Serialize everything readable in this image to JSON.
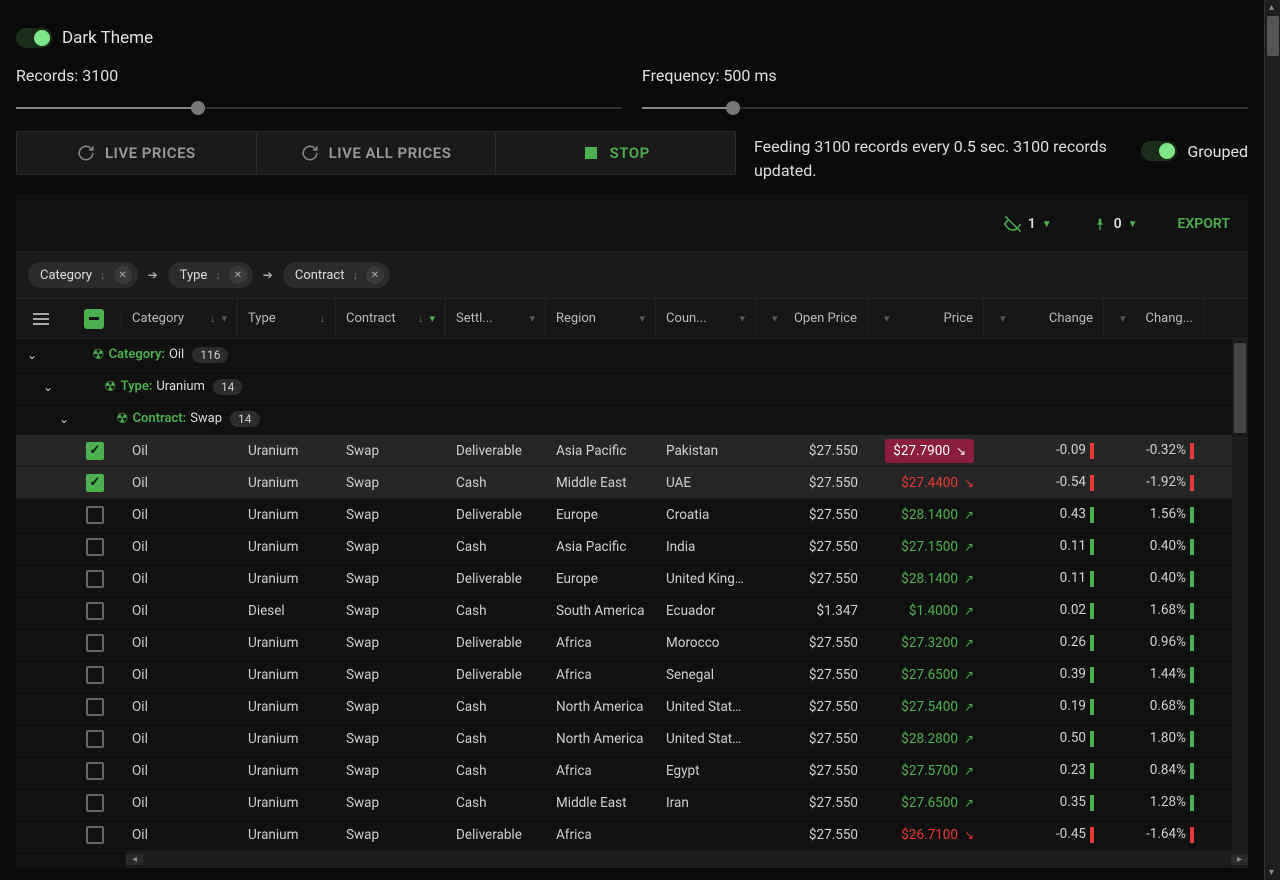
{
  "theme": {
    "label": "Dark Theme",
    "on": true
  },
  "records_slider": {
    "label": "Records: 3100",
    "percent": 30
  },
  "frequency_slider": {
    "label": "Frequency: 500 ms",
    "percent": 15
  },
  "buttons": {
    "live_prices": "LIVE PRICES",
    "live_all_prices": "LIVE ALL PRICES",
    "stop": "STOP"
  },
  "status": "Feeding 3100 records every 0.5 sec. 3100 records updated.",
  "grouped": {
    "label": "Grouped",
    "on": true
  },
  "actions": {
    "hidden_count": "1",
    "pinned_count": "0",
    "export": "EXPORT"
  },
  "groupby": [
    {
      "label": "Category"
    },
    {
      "label": "Type"
    },
    {
      "label": "Contract"
    }
  ],
  "columns": {
    "category": "Category",
    "type": "Type",
    "contract": "Contract",
    "settlement": "Settl...",
    "region": "Region",
    "country": "Coun...",
    "open_price": "Open Price",
    "price": "Price",
    "change": "Change",
    "change_pct": "Chang..."
  },
  "groups": {
    "g1": {
      "label": "Category:",
      "value": "Oil",
      "count": "116"
    },
    "g2": {
      "label": "Type:",
      "value": "Uranium",
      "count": "14"
    },
    "g3": {
      "label": "Contract:",
      "value": "Swap",
      "count": "14"
    }
  },
  "rows": [
    {
      "selected": true,
      "category": "Oil",
      "type": "Uranium",
      "contract": "Swap",
      "settlement": "Deliverable",
      "region": "Asia Pacific",
      "country": "Pakistan",
      "open_price": "$27.550",
      "price": "$27.7900",
      "dir": "down",
      "badge": true,
      "change": "-0.09",
      "chbar": "down",
      "change_pct": "-0.32%",
      "pctbar": "down"
    },
    {
      "selected": true,
      "category": "Oil",
      "type": "Uranium",
      "contract": "Swap",
      "settlement": "Cash",
      "region": "Middle East",
      "country": "UAE",
      "open_price": "$27.550",
      "price": "$27.4400",
      "dir": "down",
      "badge": false,
      "change": "-0.54",
      "chbar": "down",
      "change_pct": "-1.92%",
      "pctbar": "down"
    },
    {
      "selected": false,
      "category": "Oil",
      "type": "Uranium",
      "contract": "Swap",
      "settlement": "Deliverable",
      "region": "Europe",
      "country": "Croatia",
      "open_price": "$27.550",
      "price": "$28.1400",
      "dir": "up",
      "badge": false,
      "change": "0.43",
      "chbar": "up",
      "change_pct": "1.56%",
      "pctbar": "up"
    },
    {
      "selected": false,
      "category": "Oil",
      "type": "Uranium",
      "contract": "Swap",
      "settlement": "Cash",
      "region": "Asia Pacific",
      "country": "India",
      "open_price": "$27.550",
      "price": "$27.1500",
      "dir": "up",
      "badge": false,
      "change": "0.11",
      "chbar": "up",
      "change_pct": "0.40%",
      "pctbar": "up"
    },
    {
      "selected": false,
      "category": "Oil",
      "type": "Uranium",
      "contract": "Swap",
      "settlement": "Deliverable",
      "region": "Europe",
      "country": "United King…",
      "open_price": "$27.550",
      "price": "$28.1400",
      "dir": "up",
      "badge": false,
      "change": "0.11",
      "chbar": "up",
      "change_pct": "0.40%",
      "pctbar": "up"
    },
    {
      "selected": false,
      "category": "Oil",
      "type": "Diesel",
      "contract": "Swap",
      "settlement": "Cash",
      "region": "South America",
      "country": "Ecuador",
      "open_price": "$1.347",
      "price": "$1.4000",
      "dir": "up",
      "badge": false,
      "change": "0.02",
      "chbar": "up",
      "change_pct": "1.68%",
      "pctbar": "up"
    },
    {
      "selected": false,
      "category": "Oil",
      "type": "Uranium",
      "contract": "Swap",
      "settlement": "Deliverable",
      "region": "Africa",
      "country": "Morocco",
      "open_price": "$27.550",
      "price": "$27.3200",
      "dir": "up",
      "badge": false,
      "change": "0.26",
      "chbar": "up",
      "change_pct": "0.96%",
      "pctbar": "up"
    },
    {
      "selected": false,
      "category": "Oil",
      "type": "Uranium",
      "contract": "Swap",
      "settlement": "Deliverable",
      "region": "Africa",
      "country": "Senegal",
      "open_price": "$27.550",
      "price": "$27.6500",
      "dir": "up",
      "badge": false,
      "change": "0.39",
      "chbar": "up",
      "change_pct": "1.44%",
      "pctbar": "up"
    },
    {
      "selected": false,
      "category": "Oil",
      "type": "Uranium",
      "contract": "Swap",
      "settlement": "Cash",
      "region": "North America",
      "country": "United States",
      "open_price": "$27.550",
      "price": "$27.5400",
      "dir": "up",
      "badge": false,
      "change": "0.19",
      "chbar": "up",
      "change_pct": "0.68%",
      "pctbar": "up"
    },
    {
      "selected": false,
      "category": "Oil",
      "type": "Uranium",
      "contract": "Swap",
      "settlement": "Cash",
      "region": "North America",
      "country": "United States",
      "open_price": "$27.550",
      "price": "$28.2800",
      "dir": "up",
      "badge": false,
      "change": "0.50",
      "chbar": "up",
      "change_pct": "1.80%",
      "pctbar": "up"
    },
    {
      "selected": false,
      "category": "Oil",
      "type": "Uranium",
      "contract": "Swap",
      "settlement": "Cash",
      "region": "Africa",
      "country": "Egypt",
      "open_price": "$27.550",
      "price": "$27.5700",
      "dir": "up",
      "badge": false,
      "change": "0.23",
      "chbar": "up",
      "change_pct": "0.84%",
      "pctbar": "up"
    },
    {
      "selected": false,
      "category": "Oil",
      "type": "Uranium",
      "contract": "Swap",
      "settlement": "Cash",
      "region": "Middle East",
      "country": "Iran",
      "open_price": "$27.550",
      "price": "$27.6500",
      "dir": "up",
      "badge": false,
      "change": "0.35",
      "chbar": "up",
      "change_pct": "1.28%",
      "pctbar": "up"
    },
    {
      "selected": false,
      "category": "Oil",
      "type": "Uranium",
      "contract": "Swap",
      "settlement": "Deliverable",
      "region": "Africa",
      "country": "",
      "open_price": "$27.550",
      "price": "$26.7100",
      "dir": "down",
      "badge": false,
      "change": "-0.45",
      "chbar": "down",
      "change_pct": "-1.64%",
      "pctbar": "down"
    }
  ]
}
